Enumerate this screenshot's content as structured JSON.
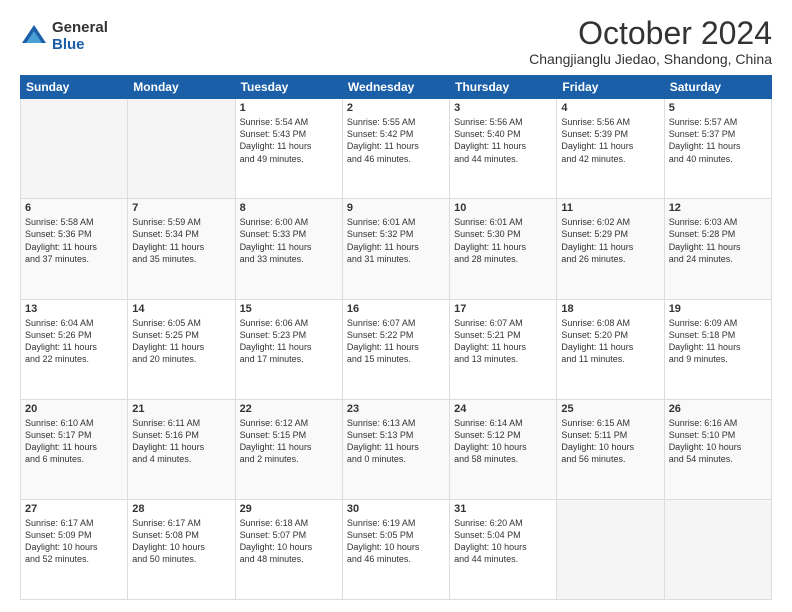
{
  "logo": {
    "general": "General",
    "blue": "Blue"
  },
  "header": {
    "month": "October 2024",
    "location": "Changjianglu Jiedao, Shandong, China"
  },
  "weekdays": [
    "Sunday",
    "Monday",
    "Tuesday",
    "Wednesday",
    "Thursday",
    "Friday",
    "Saturday"
  ],
  "weeks": [
    [
      {
        "day": "",
        "info": ""
      },
      {
        "day": "",
        "info": ""
      },
      {
        "day": "1",
        "info": "Sunrise: 5:54 AM\nSunset: 5:43 PM\nDaylight: 11 hours\nand 49 minutes."
      },
      {
        "day": "2",
        "info": "Sunrise: 5:55 AM\nSunset: 5:42 PM\nDaylight: 11 hours\nand 46 minutes."
      },
      {
        "day": "3",
        "info": "Sunrise: 5:56 AM\nSunset: 5:40 PM\nDaylight: 11 hours\nand 44 minutes."
      },
      {
        "day": "4",
        "info": "Sunrise: 5:56 AM\nSunset: 5:39 PM\nDaylight: 11 hours\nand 42 minutes."
      },
      {
        "day": "5",
        "info": "Sunrise: 5:57 AM\nSunset: 5:37 PM\nDaylight: 11 hours\nand 40 minutes."
      }
    ],
    [
      {
        "day": "6",
        "info": "Sunrise: 5:58 AM\nSunset: 5:36 PM\nDaylight: 11 hours\nand 37 minutes."
      },
      {
        "day": "7",
        "info": "Sunrise: 5:59 AM\nSunset: 5:34 PM\nDaylight: 11 hours\nand 35 minutes."
      },
      {
        "day": "8",
        "info": "Sunrise: 6:00 AM\nSunset: 5:33 PM\nDaylight: 11 hours\nand 33 minutes."
      },
      {
        "day": "9",
        "info": "Sunrise: 6:01 AM\nSunset: 5:32 PM\nDaylight: 11 hours\nand 31 minutes."
      },
      {
        "day": "10",
        "info": "Sunrise: 6:01 AM\nSunset: 5:30 PM\nDaylight: 11 hours\nand 28 minutes."
      },
      {
        "day": "11",
        "info": "Sunrise: 6:02 AM\nSunset: 5:29 PM\nDaylight: 11 hours\nand 26 minutes."
      },
      {
        "day": "12",
        "info": "Sunrise: 6:03 AM\nSunset: 5:28 PM\nDaylight: 11 hours\nand 24 minutes."
      }
    ],
    [
      {
        "day": "13",
        "info": "Sunrise: 6:04 AM\nSunset: 5:26 PM\nDaylight: 11 hours\nand 22 minutes."
      },
      {
        "day": "14",
        "info": "Sunrise: 6:05 AM\nSunset: 5:25 PM\nDaylight: 11 hours\nand 20 minutes."
      },
      {
        "day": "15",
        "info": "Sunrise: 6:06 AM\nSunset: 5:23 PM\nDaylight: 11 hours\nand 17 minutes."
      },
      {
        "day": "16",
        "info": "Sunrise: 6:07 AM\nSunset: 5:22 PM\nDaylight: 11 hours\nand 15 minutes."
      },
      {
        "day": "17",
        "info": "Sunrise: 6:07 AM\nSunset: 5:21 PM\nDaylight: 11 hours\nand 13 minutes."
      },
      {
        "day": "18",
        "info": "Sunrise: 6:08 AM\nSunset: 5:20 PM\nDaylight: 11 hours\nand 11 minutes."
      },
      {
        "day": "19",
        "info": "Sunrise: 6:09 AM\nSunset: 5:18 PM\nDaylight: 11 hours\nand 9 minutes."
      }
    ],
    [
      {
        "day": "20",
        "info": "Sunrise: 6:10 AM\nSunset: 5:17 PM\nDaylight: 11 hours\nand 6 minutes."
      },
      {
        "day": "21",
        "info": "Sunrise: 6:11 AM\nSunset: 5:16 PM\nDaylight: 11 hours\nand 4 minutes."
      },
      {
        "day": "22",
        "info": "Sunrise: 6:12 AM\nSunset: 5:15 PM\nDaylight: 11 hours\nand 2 minutes."
      },
      {
        "day": "23",
        "info": "Sunrise: 6:13 AM\nSunset: 5:13 PM\nDaylight: 11 hours\nand 0 minutes."
      },
      {
        "day": "24",
        "info": "Sunrise: 6:14 AM\nSunset: 5:12 PM\nDaylight: 10 hours\nand 58 minutes."
      },
      {
        "day": "25",
        "info": "Sunrise: 6:15 AM\nSunset: 5:11 PM\nDaylight: 10 hours\nand 56 minutes."
      },
      {
        "day": "26",
        "info": "Sunrise: 6:16 AM\nSunset: 5:10 PM\nDaylight: 10 hours\nand 54 minutes."
      }
    ],
    [
      {
        "day": "27",
        "info": "Sunrise: 6:17 AM\nSunset: 5:09 PM\nDaylight: 10 hours\nand 52 minutes."
      },
      {
        "day": "28",
        "info": "Sunrise: 6:17 AM\nSunset: 5:08 PM\nDaylight: 10 hours\nand 50 minutes."
      },
      {
        "day": "29",
        "info": "Sunrise: 6:18 AM\nSunset: 5:07 PM\nDaylight: 10 hours\nand 48 minutes."
      },
      {
        "day": "30",
        "info": "Sunrise: 6:19 AM\nSunset: 5:05 PM\nDaylight: 10 hours\nand 46 minutes."
      },
      {
        "day": "31",
        "info": "Sunrise: 6:20 AM\nSunset: 5:04 PM\nDaylight: 10 hours\nand 44 minutes."
      },
      {
        "day": "",
        "info": ""
      },
      {
        "day": "",
        "info": ""
      }
    ]
  ]
}
